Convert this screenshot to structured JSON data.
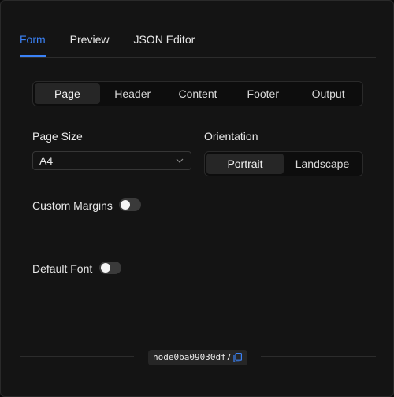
{
  "tabs": [
    {
      "label": "Form",
      "active": true
    },
    {
      "label": "Preview",
      "active": false
    },
    {
      "label": "JSON Editor",
      "active": false
    }
  ],
  "sections": [
    {
      "label": "Page",
      "active": true
    },
    {
      "label": "Header",
      "active": false
    },
    {
      "label": "Content",
      "active": false
    },
    {
      "label": "Footer",
      "active": false
    },
    {
      "label": "Output",
      "active": false
    }
  ],
  "page_size": {
    "label": "Page Size",
    "value": "A4"
  },
  "orientation": {
    "label": "Orientation",
    "options": [
      {
        "label": "Portrait",
        "active": true
      },
      {
        "label": "Landscape",
        "active": false
      }
    ]
  },
  "custom_margins": {
    "label": "Custom Margins",
    "enabled": false
  },
  "default_font": {
    "label": "Default Font",
    "enabled": false
  },
  "footer": {
    "node_id": "node0ba09030df7",
    "copy_icon": "copy-icon"
  },
  "colors": {
    "accent": "#3b82f6",
    "background": "#141414",
    "segment_active": "#262626"
  }
}
